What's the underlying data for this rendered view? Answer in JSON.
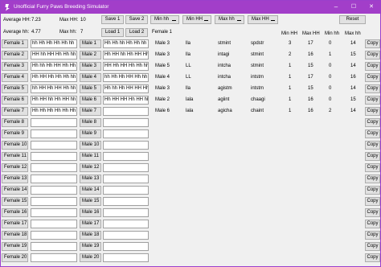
{
  "window": {
    "title": "Unofficial Furry Paws Breeding Simulator",
    "title_bar_color": "#a23ec9",
    "minimize_glyph": "–",
    "maximize_glyph": "☐",
    "close_glyph": "✕"
  },
  "stats": {
    "avg_hh_label": "Average HH:",
    "avg_hh_value": "7.23",
    "max_hh_label": "Max HH:",
    "max_hh_value": "10",
    "avg_hh_lower_label": "Average hh:",
    "avg_hh_lower_value": "4.77",
    "max_hh_lower_label": "Max hh:",
    "max_hh_lower_value": "7"
  },
  "buttons": {
    "save1": "Save 1",
    "save2": "Save 2",
    "load1": "Load 1",
    "load2": "Load 2",
    "reset": "Reset"
  },
  "filters": [
    "Min hh",
    "Min HH",
    "Max hh",
    "Max HH"
  ],
  "females": [
    {
      "label": "Female 1",
      "value": "hh Hh Hh Hh Hh hh"
    },
    {
      "label": "Female 2",
      "value": "HH hh HH Hh Hh hh"
    },
    {
      "label": "Female 3",
      "value": "Hh hh Hh HH Hh Hh"
    },
    {
      "label": "Female 4",
      "value": "Hh HH Hh Hh Hh hh"
    },
    {
      "label": "Female 5",
      "value": "hh HH Hh HH Hh hh"
    },
    {
      "label": "Female 6",
      "value": "Hh HH hh Hh HH hh"
    },
    {
      "label": "Female 7",
      "value": "Hh Hh Hh Hh Hh Hh"
    },
    {
      "label": "Female 8",
      "value": ""
    },
    {
      "label": "Female 9",
      "value": ""
    },
    {
      "label": "Female 10",
      "value": ""
    },
    {
      "label": "Female 11",
      "value": ""
    },
    {
      "label": "Female 12",
      "value": ""
    },
    {
      "label": "Female 13",
      "value": ""
    },
    {
      "label": "Female 14",
      "value": ""
    },
    {
      "label": "Female 15",
      "value": ""
    },
    {
      "label": "Female 16",
      "value": ""
    },
    {
      "label": "Female 17",
      "value": ""
    },
    {
      "label": "Female 18",
      "value": ""
    },
    {
      "label": "Female 19",
      "value": ""
    },
    {
      "label": "Female 20",
      "value": ""
    }
  ],
  "males": [
    {
      "label": "Male 1",
      "value": "Hh Hh hh Hh Hh hh"
    },
    {
      "label": "Male 2",
      "value": "Hh HH hh Hh HH Hh"
    },
    {
      "label": "Male 3",
      "value": "HH Hh HH Hh Hh hh"
    },
    {
      "label": "Male 4",
      "value": "hh Hh Hh HH Hh hh"
    },
    {
      "label": "Male 5",
      "value": "Hh hh Hh HH HH Hh"
    },
    {
      "label": "Male 6",
      "value": "Hh HH HH Hh HH hh"
    },
    {
      "label": "Male 7",
      "value": ""
    },
    {
      "label": "Male 8",
      "value": ""
    },
    {
      "label": "Male 9",
      "value": ""
    },
    {
      "label": "Male 10",
      "value": ""
    },
    {
      "label": "Male 11",
      "value": ""
    },
    {
      "label": "Male 12",
      "value": ""
    },
    {
      "label": "Male 13",
      "value": ""
    },
    {
      "label": "Male 14",
      "value": ""
    },
    {
      "label": "Male 15",
      "value": ""
    },
    {
      "label": "Male 16",
      "value": ""
    },
    {
      "label": "Male 17",
      "value": ""
    },
    {
      "label": "Male 18",
      "value": ""
    },
    {
      "label": "Male 19",
      "value": ""
    },
    {
      "label": "Male 20",
      "value": ""
    }
  ],
  "results": {
    "headers": [
      "Min HH",
      "Max HH",
      "Min hh",
      "Max hh"
    ],
    "copy_label": "Copy",
    "copy_count": 20,
    "rows": [
      {
        "female": "Female 1",
        "male": "Male 3",
        "female_code": "lla",
        "male_code": "stmint",
        "result": "spdstr",
        "min_HH": "3",
        "max_HH": "17",
        "min_hh": "0",
        "max_hh": "14"
      },
      {
        "female": "",
        "male": "Male 3",
        "female_code": "lla",
        "male_code": "intagi",
        "result": "stmint",
        "min_HH": "2",
        "max_HH": "16",
        "min_hh": "1",
        "max_hh": "15"
      },
      {
        "female": "",
        "male": "Male 5",
        "female_code": "LL",
        "male_code": "intcha",
        "result": "stmint",
        "min_HH": "1",
        "max_HH": "15",
        "min_hh": "0",
        "max_hh": "14"
      },
      {
        "female": "",
        "male": "Male 4",
        "female_code": "LL",
        "male_code": "intcha",
        "result": "intstm",
        "min_HH": "1",
        "max_HH": "17",
        "min_hh": "0",
        "max_hh": "16"
      },
      {
        "female": "",
        "male": "Male 3",
        "female_code": "lla",
        "male_code": "agistm",
        "result": "intstm",
        "min_HH": "1",
        "max_HH": "15",
        "min_hh": "0",
        "max_hh": "14"
      },
      {
        "female": "",
        "male": "Male 2",
        "female_code": "lala",
        "male_code": "agiint",
        "result": "chaagi",
        "min_HH": "1",
        "max_HH": "16",
        "min_hh": "0",
        "max_hh": "15"
      },
      {
        "female": "",
        "male": "Male 6",
        "female_code": "lala",
        "male_code": "agicha",
        "result": "chaint",
        "min_HH": "1",
        "max_HH": "16",
        "min_hh": "2",
        "max_hh": "14"
      }
    ]
  }
}
